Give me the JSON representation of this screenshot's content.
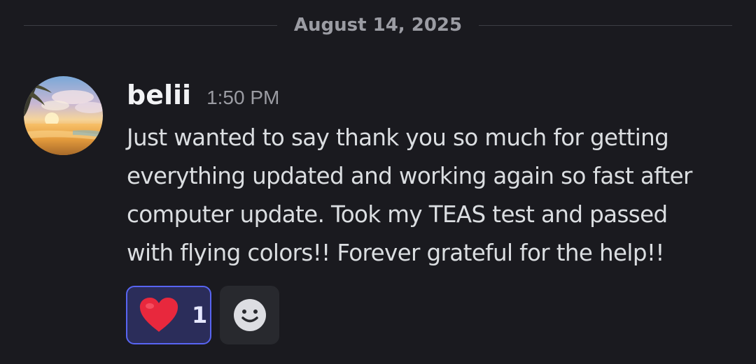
{
  "divider": {
    "date": "August 14, 2025"
  },
  "message": {
    "author": "belii",
    "timestamp": "1:50 PM",
    "lines": [
      "Just wanted to say thank you so much for getting",
      "everything updated and working again so fast after",
      "computer update. Took my TEAS test and passed",
      "with flying colors!! Forever grateful for the help!!"
    ],
    "avatar_icon": "beach-sunset-avatar"
  },
  "reactions": [
    {
      "emoji": "heart-icon",
      "count": "1",
      "selected": true
    }
  ],
  "add_reaction_icon": "smiley-add-reaction-icon",
  "colors": {
    "background": "#1a1a1f",
    "reaction_bg": "#2b2d5a",
    "reaction_border": "#5865f2",
    "heart": "#e8283d"
  }
}
